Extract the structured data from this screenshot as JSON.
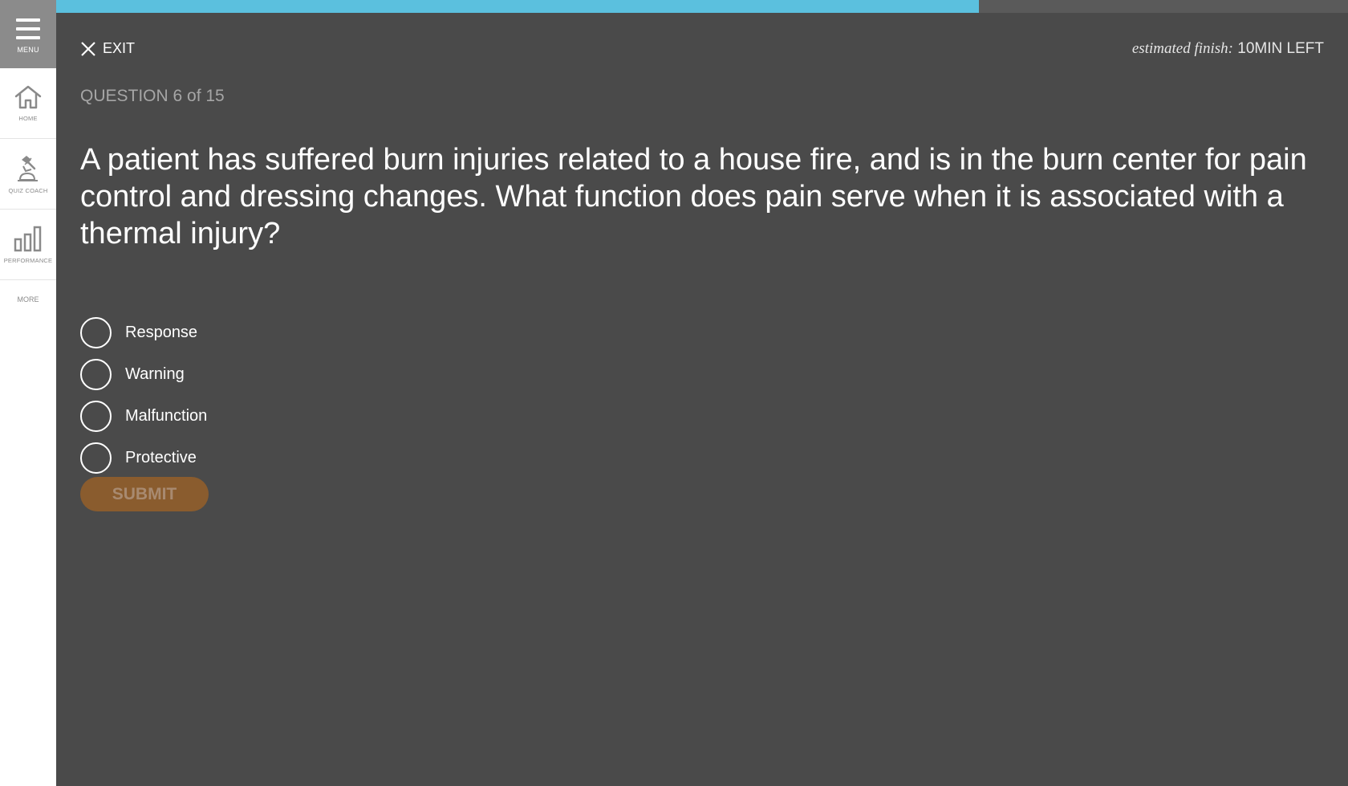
{
  "sidebar": {
    "menu_label": "MENU",
    "items": [
      {
        "label": "HOME",
        "icon": "home-icon"
      },
      {
        "label": "QUIZ COACH",
        "icon": "quiz-coach-icon"
      },
      {
        "label": "PERFORMANCE",
        "icon": "bar-chart-icon"
      }
    ],
    "more_label": "MORE"
  },
  "progress": {
    "fraction": 0.7143,
    "fill_color": "#5bc0de"
  },
  "header": {
    "exit_label": "EXIT",
    "estimate_label": "estimated finish:",
    "estimate_value": "10MIN LEFT"
  },
  "question": {
    "number_text": "QUESTION 6 of 15",
    "text": "A patient has suffered burn injuries related to a house fire, and is in the burn center for pain control and dressing changes. What function does pain serve when it is associated with a thermal injury?",
    "options": [
      {
        "label": "Response",
        "selected": false
      },
      {
        "label": "Warning",
        "selected": false
      },
      {
        "label": "Malfunction",
        "selected": false
      },
      {
        "label": "Protective",
        "selected": false
      }
    ]
  },
  "submit": {
    "label": "SUBMIT",
    "color": "#8a5c2e"
  },
  "colors": {
    "background": "#4a4a4a",
    "sidebar": "#ffffff",
    "menu_button": "#8b8b8b"
  }
}
